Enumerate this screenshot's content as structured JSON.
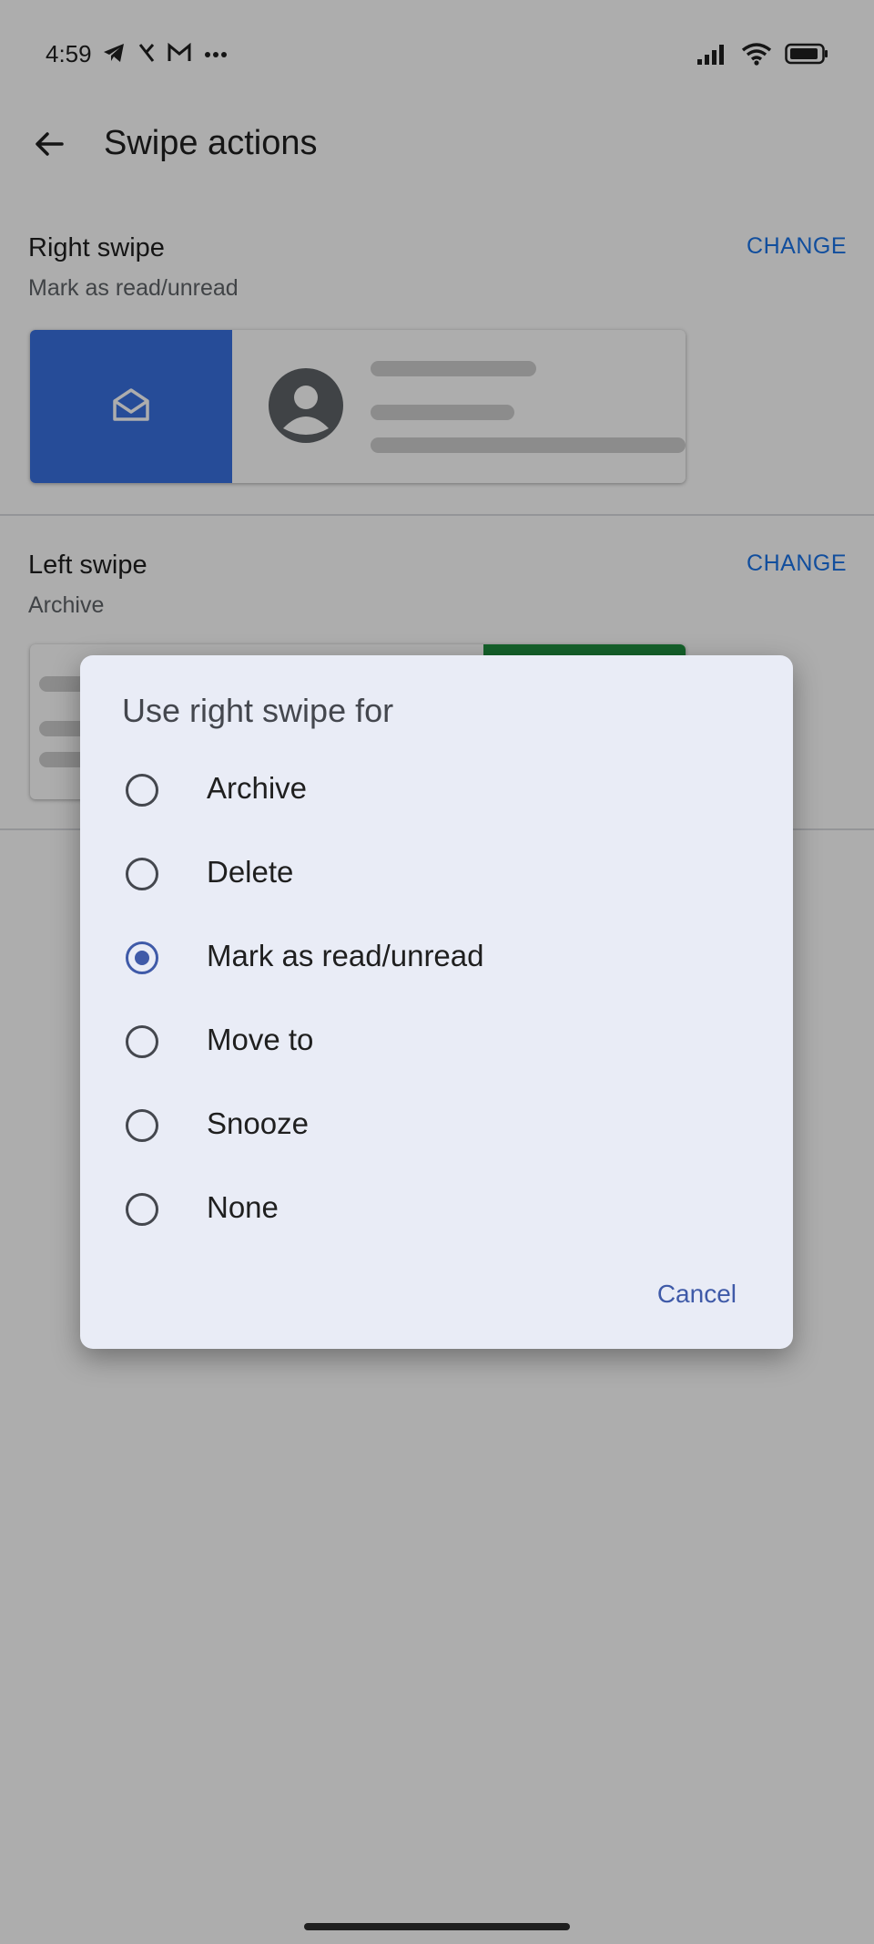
{
  "status_bar": {
    "time": "4:59",
    "left_icons": [
      "telegram-icon",
      "x-icon",
      "gmail-icon",
      "more-dots-icon"
    ],
    "right_icons": [
      "signal-icon",
      "wifi-icon",
      "battery-icon"
    ]
  },
  "app_bar": {
    "title": "Swipe actions",
    "back_icon": "arrow-back-icon"
  },
  "right_swipe": {
    "title": "Right swipe",
    "subtitle": "Mark as read/unread",
    "change_label": "CHANGE",
    "action_color": "#3871e0",
    "action_icon": "mark-read-envelope-icon"
  },
  "left_swipe": {
    "title": "Left swipe",
    "subtitle": "Archive",
    "change_label": "CHANGE",
    "action_color": "#1e8e3e"
  },
  "dialog": {
    "title": "Use right swipe for",
    "options": [
      {
        "label": "Archive",
        "selected": false
      },
      {
        "label": "Delete",
        "selected": false
      },
      {
        "label": "Mark as read/unread",
        "selected": true
      },
      {
        "label": "Move to",
        "selected": false
      },
      {
        "label": "Snooze",
        "selected": false
      },
      {
        "label": "None",
        "selected": false
      }
    ],
    "cancel_label": "Cancel"
  },
  "colors": {
    "accent": "#1a73e8",
    "dialog_accent": "#3f5aa8",
    "dialog_bg": "#e9ecf6"
  }
}
